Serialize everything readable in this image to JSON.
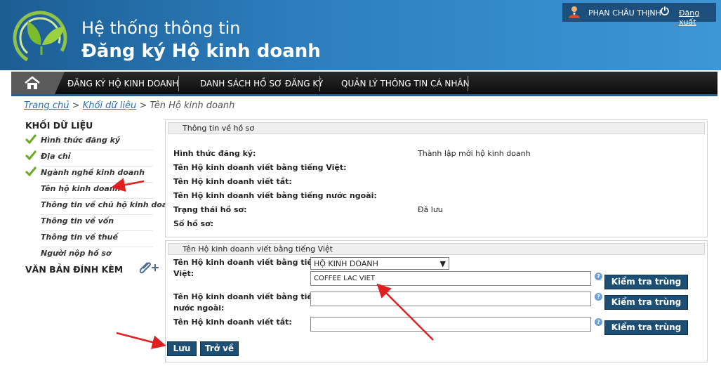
{
  "header": {
    "title_line1": "Hệ thống thông tin",
    "title_line2": "Đăng ký Hộ kinh doanh",
    "user_name": "PHAN CHÂU THỊNH",
    "logout_label": "Đăng xuất"
  },
  "nav": {
    "items": [
      {
        "label": "ĐĂNG KÝ HỘ KINH DOANH"
      },
      {
        "label": "DANH SÁCH HỒ SƠ ĐĂNG KÝ"
      },
      {
        "label": "QUẢN LÝ THÔNG TIN CÁ NHÂN"
      }
    ]
  },
  "breadcrumb": {
    "home": "Trang chủ",
    "section": "Khối dữ liệu",
    "current": "Tên Hộ kinh doanh",
    "sep": ">"
  },
  "sidebar": {
    "title": "KHỐI DỮ LIỆU",
    "items": [
      {
        "label": "Hình thức đăng ký",
        "done": true
      },
      {
        "label": "Địa chỉ",
        "done": true
      },
      {
        "label": "Ngành nghề kinh doanh",
        "done": true
      },
      {
        "label": "Tên hộ kinh doanh",
        "done": false
      },
      {
        "label": "Thông tin về chủ hộ kinh doanh",
        "done": false
      },
      {
        "label": "Thông tin về vốn",
        "done": false
      },
      {
        "label": "Thông tin về thuế",
        "done": false
      },
      {
        "label": "Người nộp hồ sơ",
        "done": false
      }
    ],
    "attachments_title": "VĂN BẢN ĐÍNH KÈM"
  },
  "profile": {
    "heading": "Thông tin về hồ sơ",
    "rows": [
      {
        "label": "Hình thức đăng ký:",
        "value": "Thành lập mới hộ kinh doanh"
      },
      {
        "label": "Tên Hộ kinh doanh viết bằng tiếng Việt:",
        "value": ""
      },
      {
        "label": "Tên Hộ kinh doanh viết tắt:",
        "value": ""
      },
      {
        "label": "Tên Hộ kinh doanh viết bằng tiếng nước ngoài:",
        "value": ""
      },
      {
        "label": "Trạng thái hồ sơ:",
        "value": "Đã lưu"
      },
      {
        "label": "Số hồ sơ:",
        "value": ""
      }
    ]
  },
  "form": {
    "heading": "Tên Hộ kinh doanh viết bằng tiếng Việt",
    "vn_label_1": "Tên Hộ kinh doanh viết bằng tiếng",
    "vn_label_2": "Việt:",
    "prefix_selected": "HỘ KINH DOANH",
    "vn_value": "COFFEE LAC VIET",
    "foreign_label_1": "Tên Hộ kinh doanh viết bằng tiếng",
    "foreign_label_2": "nước ngoài:",
    "foreign_value": "",
    "short_label": "Tên Hộ kinh doanh viết tắt:",
    "short_value": "",
    "check_button": "Kiểm tra trùng tên",
    "help_glyph": "?",
    "save_button": "Lưu",
    "back_button": "Trở về"
  },
  "colors": {
    "header_dark": "#1c5d93",
    "header_light": "#3d96d6",
    "button": "#1d4f74",
    "arrow": "#e02020",
    "check": "#6aaa1e"
  }
}
